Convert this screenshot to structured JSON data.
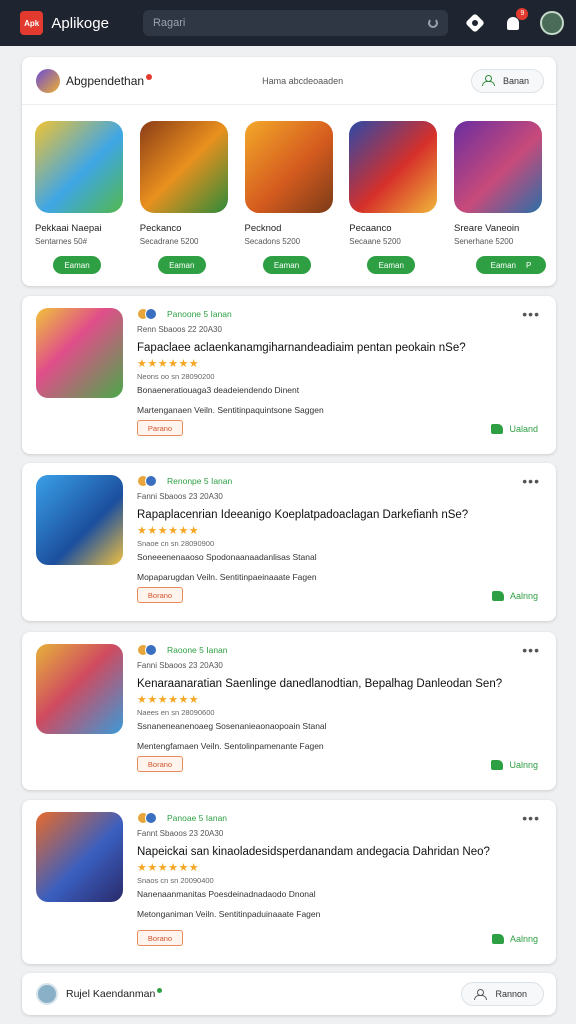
{
  "topbar": {
    "logo_text": "Apk",
    "app_title": "Aplikoge",
    "search_placeholder": "Ragari",
    "notif_count": "9",
    "icons": [
      "logo-icon",
      "mic-icon",
      "gear-icon",
      "bell-icon",
      "avatar"
    ]
  },
  "featured": {
    "name": "Abgpendethan",
    "subtitle": "Hama abcdeoaaden",
    "button_label": "Banan",
    "games": [
      {
        "name": "Pekkaai Naepai",
        "meta": "Sentarnes 50#",
        "button": "Eaman"
      },
      {
        "name": "Peckanco",
        "meta": "Secadrane 5200",
        "button": "Eaman"
      },
      {
        "name": "Pecknod",
        "meta": "Secadons 5200",
        "button": "Eaman"
      },
      {
        "name": "Pecaanco",
        "meta": "Secaane 5200",
        "button": "Eaman"
      },
      {
        "name": "Sreare Vaneoin",
        "meta": "Senerhane 5200",
        "button": "Eaman",
        "button_extra": "P"
      }
    ]
  },
  "posts": [
    {
      "publisher": "Panoone 5 Ianan",
      "date": "Renn  Sbaoos  22  20A30",
      "title": "Fapaclaee aclaenkanamgiharnandeadiaim  pentan  peokain  nSe?",
      "stars": "★★★★★★",
      "meta1": "Neons  oo  sn  28090200",
      "meta2": "Bonaeneratiouaga3  deadeiendendo  Dinent",
      "meta3": "Martenganaen  Veiln.  Sentitinpaquintsone  Saggen",
      "tag": "Parano",
      "like": "Ualand"
    },
    {
      "publisher": "Renonpe 5 Ianan",
      "date": "Fanni  Sbaoos  23  20A30",
      "title": "Rapaplacenrian  Ideeanigo  Koeplatpadoaclagan  Darkefianh  nSe?",
      "stars": "★★★★★★",
      "meta1": "Snaoe  cn  sn  28090900",
      "meta2": "Soneeenenaaoso  Spodonaanaadanlisas  Stanal",
      "meta3": "Mopaparugdan  Veiln.  Sentitinpaeinaaate  Fagen",
      "tag": "Borano",
      "like": "Aalnng"
    },
    {
      "publisher": "Raoone 5 Ianan",
      "date": "Fanni  Sbaoos  23  20A30",
      "title": "Kenaraanaratian  Saenlinge  danedlanodtian,  Bepalhag  Danleodan  Sen?",
      "stars": "★★★★★★",
      "meta1": "Naees  en  sn  28090600",
      "meta2": "Ssnaneneanenoaeg  Sosenanieaonaopoain  Stanal",
      "meta3": "Mentengfamaen  Veiln.  Sentolinpamenante  Fagen",
      "tag": "Borano",
      "like": "Ualnng"
    },
    {
      "publisher": "Panoae 5 Ianan",
      "date": "Fannt  Sbaoos  23  20A30",
      "title": "Napeickai  san  kinaoladesidsperdanandam  andegacia  Dahridan  Neo?",
      "stars": "★★★★★★",
      "meta1": "Snaos  cn  sn  20090400",
      "meta2": "Nanenaanmanitas  Poesdeinadnadaodo  Dnonal",
      "meta3": "Metonganiman  Veiln.  Sentitinpaduinaaate  Fagen",
      "tag": "Borano",
      "like": "Aalnng"
    }
  ],
  "bottom": {
    "name": "Rujel Kaendanman",
    "button_label": "Rannon"
  }
}
